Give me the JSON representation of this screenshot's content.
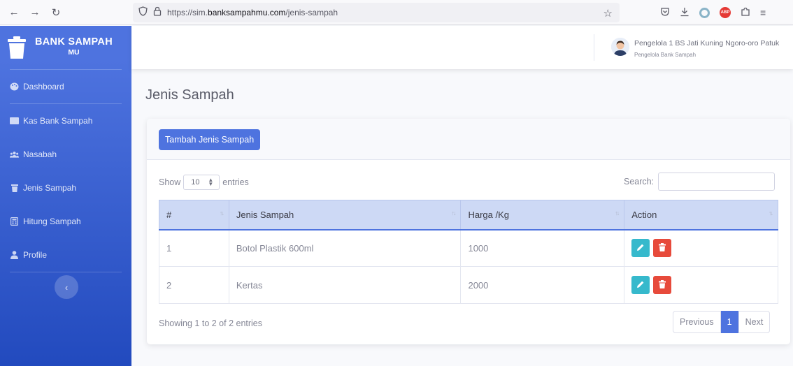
{
  "browser": {
    "url_prefix": "https://sim.",
    "url_domain": "banksampahmu.com",
    "url_path": "/jenis-sampah"
  },
  "sidebar": {
    "brand_title": "BANK SAMPAH",
    "brand_sub": "MU",
    "items": [
      {
        "label": "Dashboard",
        "icon": "palette-icon"
      },
      {
        "label": "Kas Bank Sampah",
        "icon": "cash-icon"
      },
      {
        "label": "Nasabah",
        "icon": "users-icon"
      },
      {
        "label": "Jenis Sampah",
        "icon": "trash-icon"
      },
      {
        "label": "Hitung Sampah",
        "icon": "calculator-icon"
      },
      {
        "label": "Profile",
        "icon": "user-icon"
      }
    ],
    "toggle_glyph": "‹"
  },
  "topbar": {
    "user_name": "Pengelola 1 BS Jati Kuning Ngoro-oro Patuk",
    "user_role": "Pengelola Bank Sampah"
  },
  "page": {
    "title": "Jenis Sampah",
    "add_button": "Tambah Jenis Sampah",
    "show_label": "Show",
    "entries_value": "10",
    "entries_label": "entries",
    "search_label": "Search:",
    "search_value": ""
  },
  "table": {
    "headers": [
      "#",
      "Jenis Sampah",
      "Harga /Kg",
      "Action"
    ],
    "rows": [
      {
        "no": "1",
        "jenis": "Botol Plastik 600ml",
        "harga": "1000"
      },
      {
        "no": "2",
        "jenis": "Kertas",
        "harga": "2000"
      }
    ]
  },
  "footer": {
    "info": "Showing 1 to 2 of 2 entries",
    "prev": "Previous",
    "current": "1",
    "next": "Next"
  },
  "colors": {
    "primary": "#4e73df",
    "info": "#36b9cc",
    "danger": "#e74a3b"
  }
}
